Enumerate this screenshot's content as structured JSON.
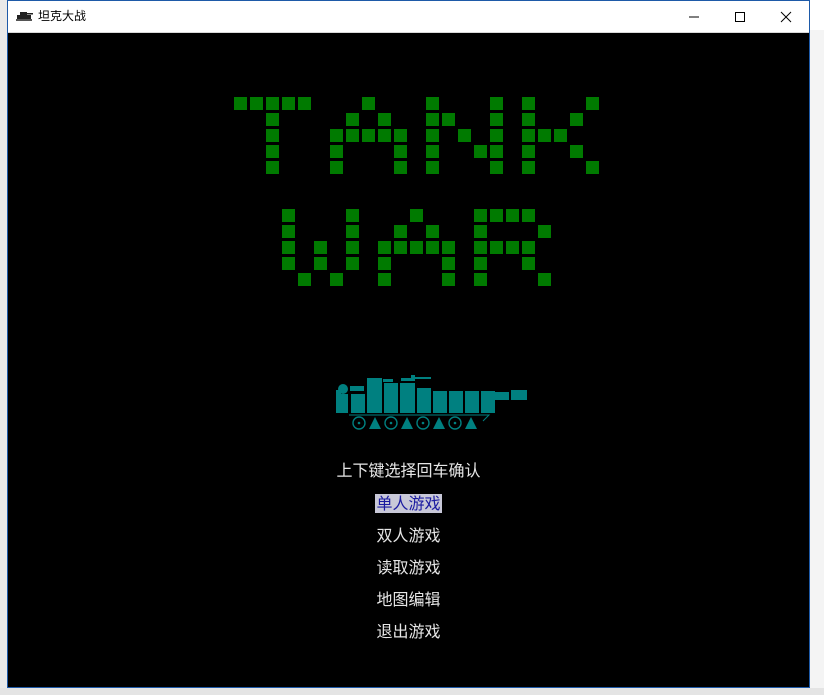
{
  "window": {
    "title": "坦克大战",
    "icon": "tank-icon",
    "controls": [
      "minimize-icon",
      "maximize-icon",
      "close-icon"
    ]
  },
  "logo": {
    "line1": "TANK",
    "line2": "WAR",
    "color": "#007a00"
  },
  "tank_graphic": {
    "icon": "tank-icon",
    "color": "#008080"
  },
  "hint": "上下键选择回车确认",
  "menu": {
    "selected_index": 0,
    "items": [
      {
        "label": "单人游戏"
      },
      {
        "label": "双人游戏"
      },
      {
        "label": "读取游戏"
      },
      {
        "label": "地图编辑"
      },
      {
        "label": "退出游戏"
      }
    ]
  },
  "colors": {
    "background": "#000000",
    "text": "#e6e6e6",
    "selection_bg": "#c8c8d8",
    "selection_fg": "#1a1aa0"
  }
}
